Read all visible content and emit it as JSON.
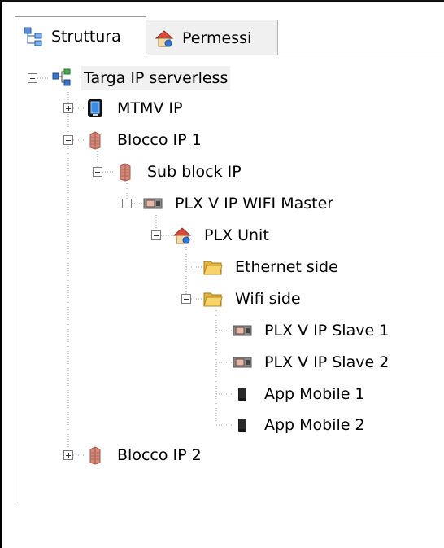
{
  "tabs": [
    {
      "label": "Struttura",
      "icon": "tree-structure-icon",
      "active": true
    },
    {
      "label": "Permessi",
      "icon": "permissions-house-icon",
      "active": false
    }
  ],
  "tree": {
    "root": {
      "label": "Targa IP serverless",
      "icon": "network-icon",
      "expanded": true,
      "selected": true
    },
    "mtmv": {
      "label": "MTMV IP",
      "icon": "monitor-device-icon",
      "expanded": false
    },
    "blocco1": {
      "label": "Blocco IP 1",
      "icon": "building-icon",
      "expanded": true
    },
    "subblock": {
      "label": "Sub block IP",
      "icon": "building-icon",
      "expanded": true
    },
    "plxmaster": {
      "label": "PLX V IP WIFI Master",
      "icon": "intercom-panel-icon",
      "expanded": true
    },
    "plxunit": {
      "label": "PLX Unit",
      "icon": "house-icon",
      "expanded": true
    },
    "ethernet": {
      "label": "Ethernet side",
      "icon": "folder-icon"
    },
    "wifi": {
      "label": "Wifi side",
      "icon": "folder-icon",
      "expanded": true
    },
    "slave1": {
      "label": "PLX V IP Slave 1",
      "icon": "intercom-panel-icon"
    },
    "slave2": {
      "label": "PLX V IP Slave 2",
      "icon": "intercom-panel-icon"
    },
    "app1": {
      "label": "App Mobile 1",
      "icon": "mobile-phone-icon"
    },
    "app2": {
      "label": "App Mobile 2",
      "icon": "mobile-phone-icon"
    },
    "blocco2": {
      "label": "Blocco IP 2",
      "icon": "building-icon",
      "expanded": false
    }
  }
}
